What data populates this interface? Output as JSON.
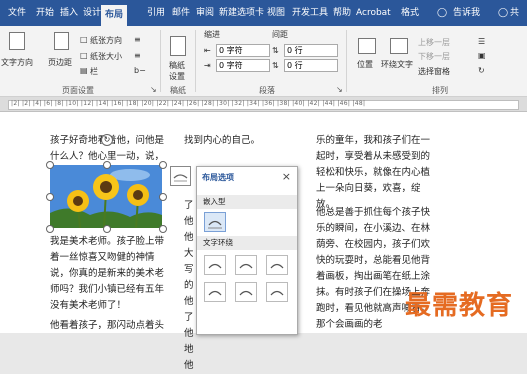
{
  "tabs": {
    "file": "文件",
    "home": "开始",
    "insert": "插入",
    "design": "设计",
    "layout": "布局",
    "references": "引用",
    "mailings": "邮件",
    "review": "审阅",
    "new_tab": "新建选项卡",
    "view": "视图",
    "developer": "开发工具",
    "help": "帮助",
    "acrobat": "Acrobat",
    "format": "格式",
    "tell_me": "告诉我",
    "share": "共"
  },
  "ribbon": {
    "text_direction": "文字方向",
    "margins": "页边距",
    "orientation": "纸张方向",
    "size": "纸张大小",
    "columns": "栏",
    "page_setup_group": "页面设置",
    "draft": "稿纸\n设置",
    "draft_group": "稿纸",
    "indent_label": "缩进",
    "spacing_label": "间距",
    "indent_left": "0 字符",
    "indent_right": "0 字符",
    "spacing_before": "0 行",
    "spacing_after": "0 行",
    "paragraph_group": "段落",
    "position": "位置",
    "wrap_text": "环绕文字",
    "bring_forward": "上移一层",
    "send_backward": "下移一层",
    "selection_pane": "选择窗格",
    "arrange_group": "排列"
  },
  "ruler_marks": "|2| |2| |4| |6| |8| |10| |12| |14| |16| |18| |20| |22| |24| |26| |28| |30| |32| |34| |36| |38| |40| |42| |44| |46| |48|",
  "document": {
    "col1_top": "孩子好奇地看着他，问他是什么人？他心里一动，说，",
    "col1_bottom": "我是美术老师。孩子脸上带着一丝惊喜又吻健的神情说，你真的是新来的美术老师吗？我们小镇已经有五年没有美术老师了！",
    "col1_last": "他看着孩子，那闪动点着头",
    "col2_top": "找到内心的自己。",
    "col2_frag": "了他他大写的他了他地他",
    "col3_a": "乐的童年，我和孩子们在一起时，享受着从未感受到的轻松和快乐，就像在内心植上一朵向日葵，欢喜，绽放。",
    "col3_b": "他总是善于抓住每个孩子快乐的瞬间，在小溪边、在林荫旁、在校园内，孩子们欢快的玩耍时，总能看见他背着画板，掏出画笔在纸上涂抹。有时孩子们在操场上奔跑时，看见他就高声喊着，那个会画画的老"
  },
  "layout_pane": {
    "title": "布局选项",
    "close": "×",
    "inline_section": "嵌入型",
    "wrap_section": "文字环绕"
  },
  "watermark": "最需教育",
  "colors": {
    "ribbon_blue": "#2b579a",
    "watermark": "#e56b22",
    "sky": "#3f7fd0"
  }
}
